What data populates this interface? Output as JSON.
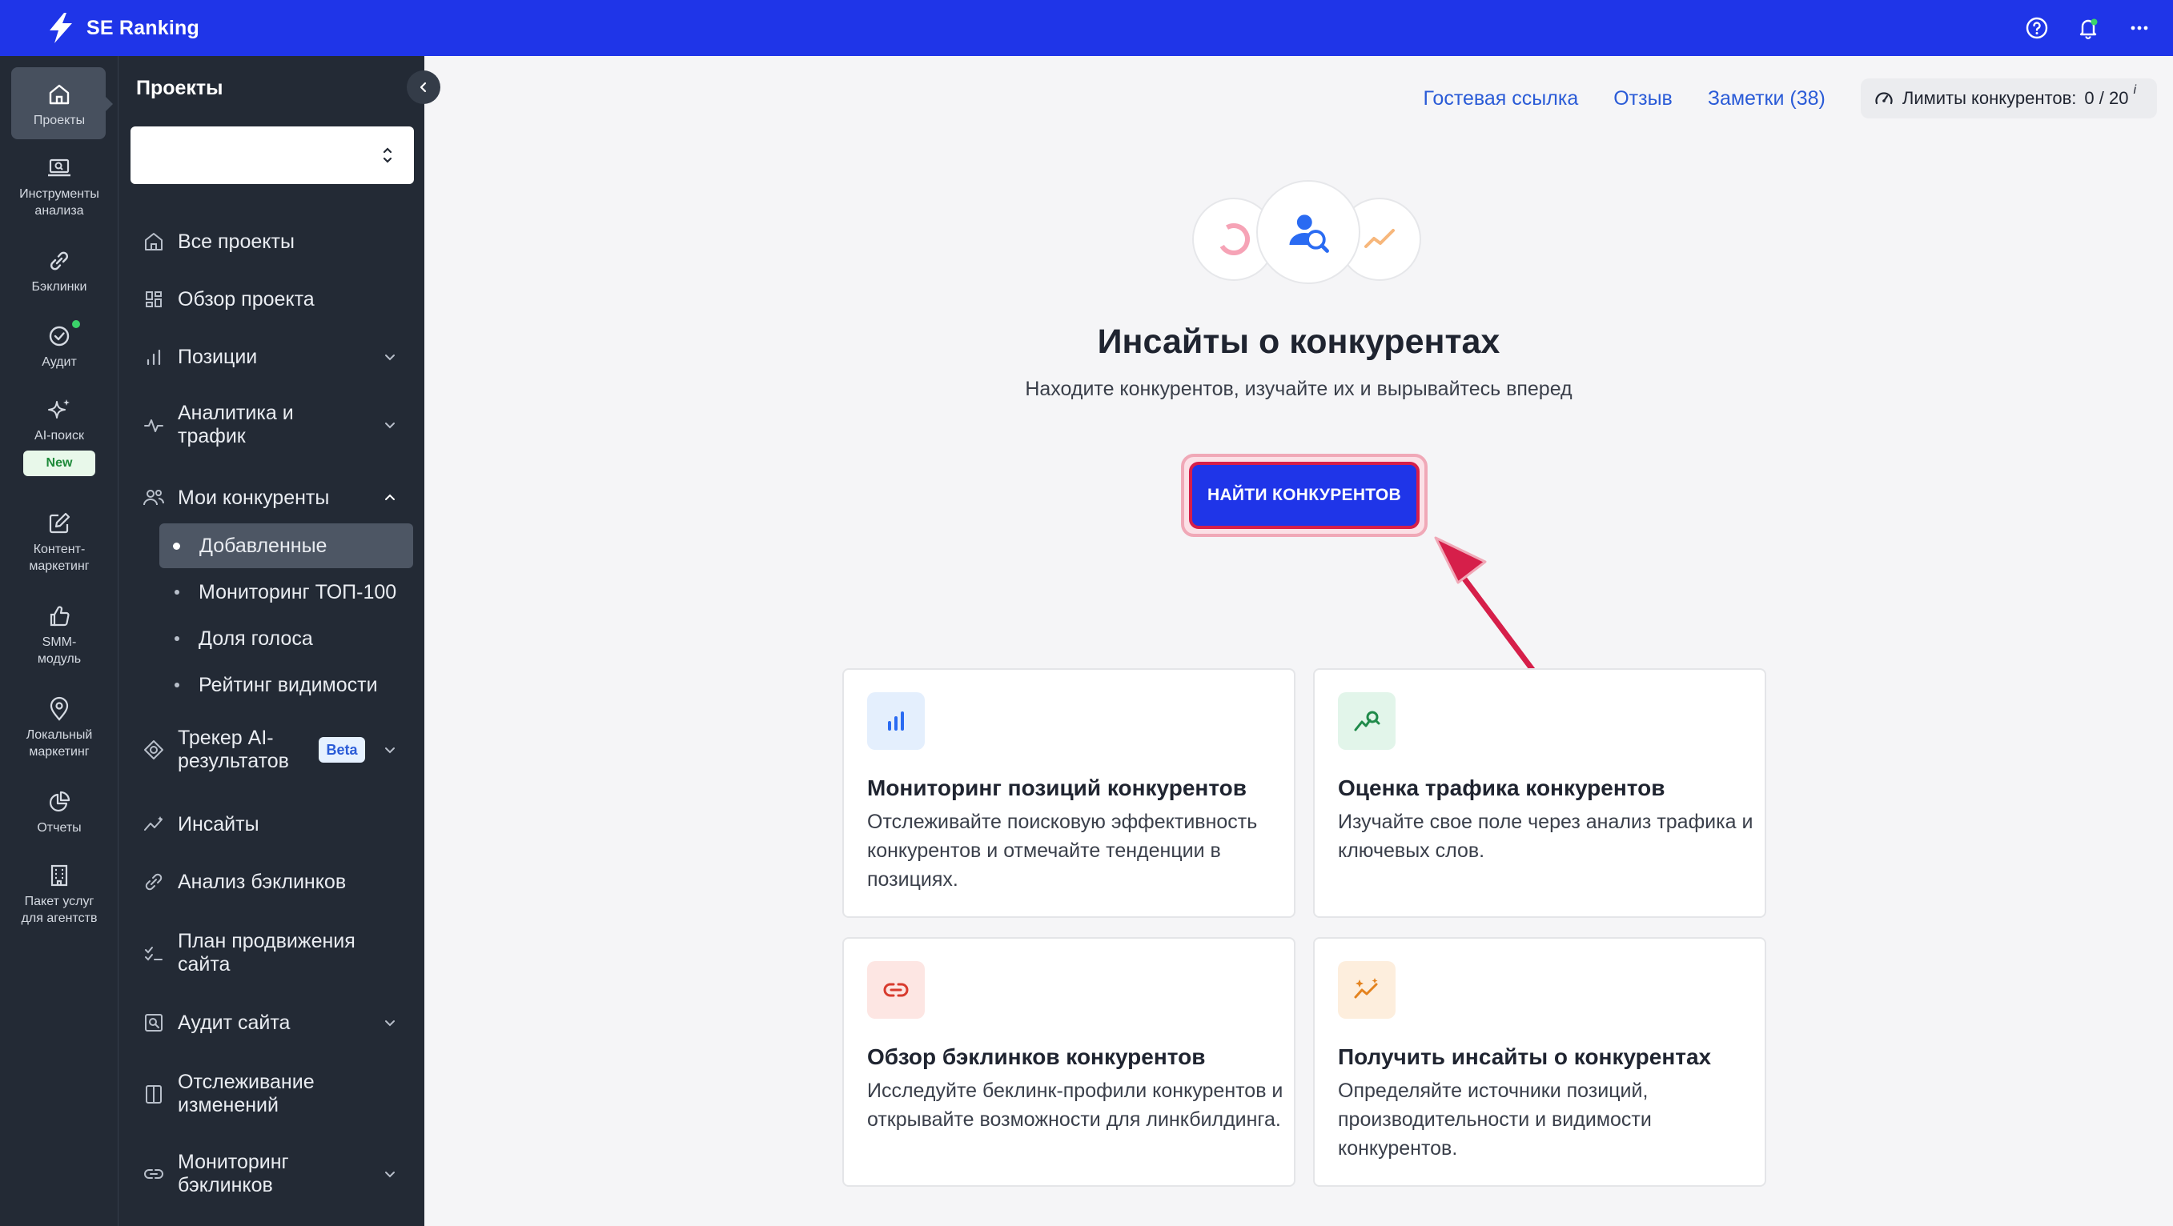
{
  "brand": {
    "name": "SE Ranking"
  },
  "rail": [
    {
      "label": "Проекты",
      "icon": "home-icon"
    },
    {
      "label": "Инструменты анализа",
      "icon": "laptop-search-icon"
    },
    {
      "label": "Бэклинки",
      "icon": "link-icon"
    },
    {
      "label": "Аудит",
      "icon": "check-circle-icon"
    },
    {
      "label": "AI-поиск",
      "icon": "sparkle-icon",
      "badge": "New"
    },
    {
      "label": "Контент-маркетинг",
      "icon": "edit-icon"
    },
    {
      "label": "SMM-модуль",
      "icon": "thumb-up-icon"
    },
    {
      "label": "Локальный маркетинг",
      "icon": "map-pin-icon"
    },
    {
      "label": "Отчеты",
      "icon": "pie-chart-icon"
    },
    {
      "label": "Пакет услуг для агентств",
      "icon": "building-icon"
    }
  ],
  "nav": {
    "title": "Проекты",
    "items": [
      {
        "label": "Все проекты"
      },
      {
        "label": "Обзор проекта"
      },
      {
        "label": "Позиции"
      },
      {
        "label": "Аналитика и трафик"
      },
      {
        "label": "Мои конкуренты"
      },
      {
        "label": "Трекер AI-результатов",
        "badge": "Beta"
      },
      {
        "label": "Инсайты"
      },
      {
        "label": "Анализ бэклинков"
      },
      {
        "label": "План продвижения сайта"
      },
      {
        "label": "Аудит сайта"
      },
      {
        "label": "Отслеживание изменений"
      },
      {
        "label": "Мониторинг бэклинков"
      }
    ],
    "subitems": [
      {
        "label": "Добавленные",
        "active": true
      },
      {
        "label": "Мониторинг ТОП-100"
      },
      {
        "label": "Доля голоса"
      },
      {
        "label": "Рейтинг видимости"
      }
    ]
  },
  "header_links": {
    "guest_link": "Гостевая ссылка",
    "feedback": "Отзыв",
    "notes": "Заметки (38)",
    "limits_label": "Лимиты конкурентов:",
    "limits_value": "0 / 20",
    "limits_info": "i"
  },
  "hero": {
    "title": "Инсайты о конкурентах",
    "subtitle": "Находите конкурентов, изучайте их и вырывайтесь вперед",
    "cta": "НАЙТИ КОНКУРЕНТОВ"
  },
  "cards": [
    {
      "title": "Мониторинг позиций конкурентов",
      "desc": "Отслеживайте поисковую эффективность конкурентов и отмечайте тенденции в позициях.",
      "icon": "bar-chart-icon"
    },
    {
      "title": "Оценка трафика конкурентов",
      "desc": "Изучайте свое поле через анализ трафика и ключевых слов.",
      "icon": "traffic-search-icon"
    },
    {
      "title": "Обзор бэклинков конкурентов",
      "desc": "Исследуйте беклинк-профили конкурентов и открывайте возможности для линкбилдинга.",
      "icon": "chain-link-icon"
    },
    {
      "title": "Получить инсайты о конкурентах",
      "desc": "Определяйте источники позиций, производительности и видимости конкурентов.",
      "icon": "trend-sparkle-icon"
    }
  ],
  "colors": {
    "topbar": "#1f35e8",
    "sidebar": "#232a35",
    "link": "#2a5bd7",
    "cta_border": "#d61f4a"
  }
}
